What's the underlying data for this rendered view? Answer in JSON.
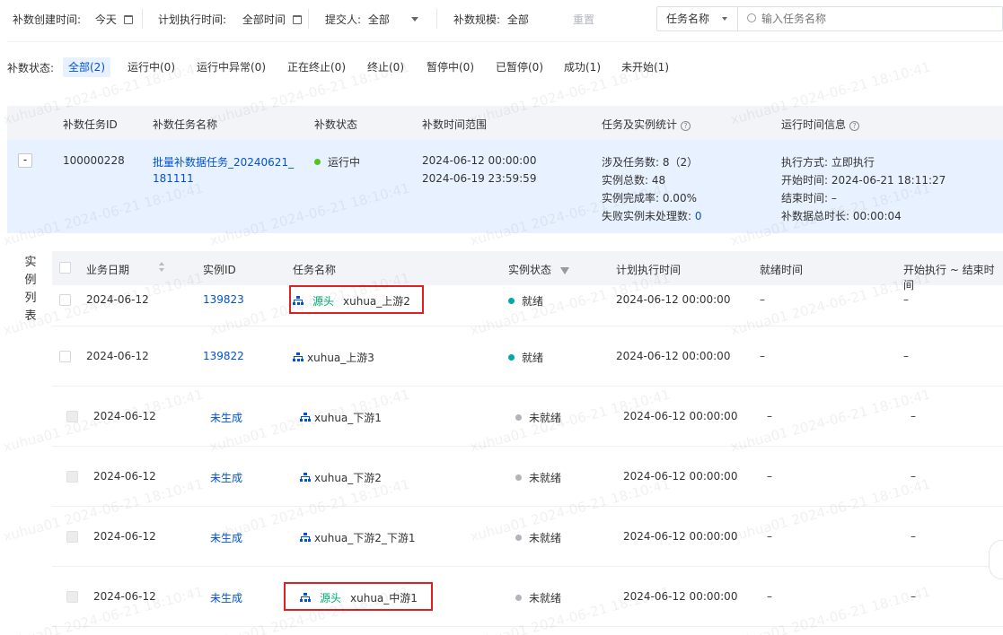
{
  "filters": {
    "create_time_label": "补数创建时间:",
    "create_time_value": "今天",
    "plan_time_label": "计划执行时间:",
    "plan_time_value": "全部时间",
    "submitter_label": "提交人:",
    "submitter_value": "全部",
    "scale_label": "补数规模:",
    "scale_value": "全部",
    "reset_label": "重置",
    "search_type": "任务名称",
    "search_placeholder": "输入任务名称"
  },
  "status_filter": {
    "label": "补数状态:",
    "tabs": [
      "全部(2)",
      "运行中(0)",
      "运行中异常(0)",
      "正在终止(0)",
      "终止(0)",
      "暂停中(0)",
      "已暂停(0)",
      "成功(1)",
      "未开始(1)"
    ]
  },
  "task_table": {
    "headers": {
      "id": "补数任务ID",
      "name": "补数任务名称",
      "status": "补数状态",
      "range": "补数时间范围",
      "stats": "任务及实例统计",
      "runtime": "运行时间信息"
    },
    "row": {
      "expand": "-",
      "id": "100000228",
      "name_line1": "批量补数据任务_20240621_",
      "name_line2": "181111",
      "status": "运行中",
      "range_start": "2024-06-12 00:00:00",
      "range_end": "2024-06-19 23:59:59",
      "stat_tasks": "涉及任务数: 8（2）",
      "stat_instances": "实例总数: 48",
      "stat_rate": "实例完成率: 0.00%",
      "stat_failed_label": "失败实例未处理数:",
      "stat_failed_value": "0",
      "run_mode": "执行方式: 立即执行",
      "run_start": "开始时间: 2024-06-21 18:11:27",
      "run_end": "结束时间: –",
      "run_duration": "补数据总时长: 00:00:04"
    }
  },
  "instance_list": {
    "side_label": [
      "实",
      "例",
      "列",
      "表"
    ],
    "headers": {
      "date": "业务日期",
      "instance_id": "实例ID",
      "task_name": "任务名称",
      "state": "实例状态",
      "plan_time": "计划执行时间",
      "ready_time": "就绪时间",
      "exec_range": "开始执行 ~ 结束时间"
    },
    "rows": [
      {
        "date": "2024-06-12",
        "instance_id": "139823",
        "tag": "源头",
        "task": "xuhua_上游2",
        "state": "就绪",
        "plan": "2024-06-12 00:00:00",
        "ready": "–",
        "exec": "–"
      },
      {
        "date": "2024-06-12",
        "instance_id": "139822",
        "tag": "",
        "task": "xuhua_上游3",
        "state": "就绪",
        "plan": "2024-06-12 00:00:00",
        "ready": "–",
        "exec": "–"
      },
      {
        "date": "2024-06-12",
        "instance_id": "未生成",
        "tag": "",
        "task": "xuhua_下游1",
        "state": "未就绪",
        "plan": "2024-06-12 00:00:00",
        "ready": "–",
        "exec": "–"
      },
      {
        "date": "2024-06-12",
        "instance_id": "未生成",
        "tag": "",
        "task": "xuhua_下游2",
        "state": "未就绪",
        "plan": "2024-06-12 00:00:00",
        "ready": "–",
        "exec": "–"
      },
      {
        "date": "2024-06-12",
        "instance_id": "未生成",
        "tag": "",
        "task": "xuhua_下游2_下游1",
        "state": "未就绪",
        "plan": "2024-06-12 00:00:00",
        "ready": "–",
        "exec": "–"
      },
      {
        "date": "2024-06-12",
        "instance_id": "未生成",
        "tag": "源头",
        "task": "xuhua_中游1",
        "state": "未就绪",
        "plan": "2024-06-12 00:00:00",
        "ready": "–",
        "exec": "–"
      }
    ]
  },
  "watermark": "xuhua01 2024-06-21 18:10:41",
  "colors": {
    "primary": "#0052d9",
    "running": "#52c41a",
    "ready": "#00a8a8",
    "not_ready": "#b0b4bb",
    "source_tag": "#00a870",
    "highlight": "#e02020"
  }
}
